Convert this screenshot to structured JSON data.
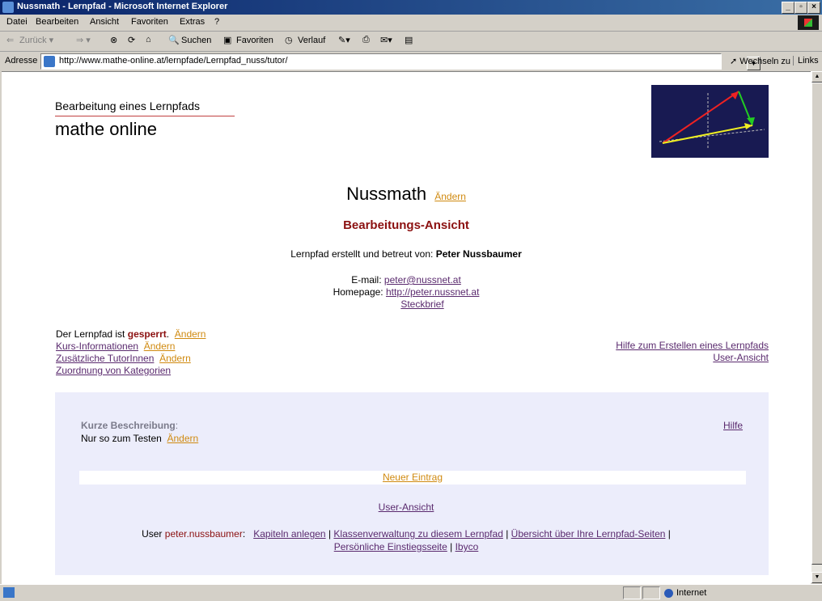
{
  "window": {
    "title": "Nussmath - Lernpfad - Microsoft Internet Explorer"
  },
  "menu": [
    "Datei",
    "Bearbeiten",
    "Ansicht",
    "Favoriten",
    "Extras",
    "?"
  ],
  "toolbar": {
    "back": "Zurück",
    "search": "Suchen",
    "favorites": "Favoriten",
    "history": "Verlauf"
  },
  "address": {
    "label": "Adresse",
    "url": "http://www.mathe-online.at/lernpfade/Lernpfad_nuss/tutor/",
    "go": "Wechseln zu",
    "links": "Links"
  },
  "header": {
    "kicker": "Bearbeitung eines Lernpfads",
    "brand": "mathe online"
  },
  "page": {
    "title": "Nussmath",
    "edit": "Ändern",
    "subtitle": "Bearbeitungs-Ansicht",
    "created_prefix": "Lernpfad erstellt und betreut von:",
    "author": "Peter Nussbaumer",
    "email_label": "E-mail:",
    "email": "peter@nussnet.at",
    "homepage_label": "Homepage:",
    "homepage": "http://peter.nussnet.at",
    "steckbrief": "Steckbrief"
  },
  "status_links": {
    "locked_prefix": "Der Lernpfad ist",
    "locked_word": "gesperrt",
    "course_info": "Kurs-Informationen",
    "tutors": "Zusätzliche TutorInnen",
    "categories": "Zuordnung von Kategorien",
    "help_create": "Hilfe zum Erstellen eines Lernpfads",
    "user_view": "User-Ansicht"
  },
  "panel": {
    "short_desc_label": "Kurze Beschreibung",
    "short_desc": "Nur so zum Testen",
    "help": "Hilfe",
    "new_entry": "Neuer Eintrag",
    "user_view": "User-Ansicht",
    "user_prefix": "User",
    "username": "peter.nussbaumer",
    "link_chapters": "Kapiteln anlegen",
    "link_classes": "Klassenverwaltung zu diesem Lernpfad",
    "link_overview": "Übersicht über Ihre Lernpfad-Seiten",
    "link_personal": "Persönliche Einstiegsseite",
    "link_ibyco": "Ibyco"
  },
  "statusbar": {
    "zone": "Internet"
  },
  "colors": {
    "accent_red": "#8b1010",
    "link_orange": "#d08a10",
    "link_purple": "#5a2a6e",
    "panel_bg": "#ecedfb"
  }
}
